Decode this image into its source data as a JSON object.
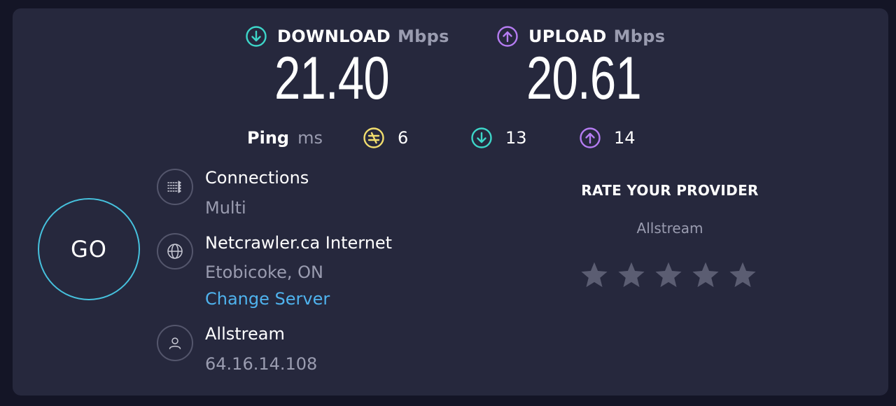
{
  "download": {
    "label": "DOWNLOAD",
    "unit": "Mbps",
    "value": "21.40",
    "icon": "download-arrow-icon",
    "color": "#3dd6c9"
  },
  "upload": {
    "label": "UPLOAD",
    "unit": "Mbps",
    "value": "20.61",
    "icon": "upload-arrow-icon",
    "color": "#b57cf2"
  },
  "ping": {
    "label": "Ping",
    "unit": "ms",
    "idle": {
      "value": "6",
      "icon": "ping-idle-icon",
      "color": "#f2de6e"
    },
    "download": {
      "value": "13",
      "icon": "download-arrow-icon",
      "color": "#3dd6c9"
    },
    "upload": {
      "value": "14",
      "icon": "upload-arrow-icon",
      "color": "#b57cf2"
    }
  },
  "go_button": {
    "label": "GO"
  },
  "connections": {
    "title": "Connections",
    "value": "Multi",
    "icon": "connections-icon"
  },
  "server": {
    "title": "Netcrawler.ca Internet",
    "location": "Etobicoke, ON",
    "change_link": "Change Server",
    "icon": "globe-icon"
  },
  "provider": {
    "title": "Allstream",
    "ip": "64.16.14.108",
    "icon": "user-icon"
  },
  "rating": {
    "title": "RATE YOUR PROVIDER",
    "provider": "Allstream",
    "stars": 5,
    "rating": 0,
    "star_color": "#5b5d72"
  }
}
